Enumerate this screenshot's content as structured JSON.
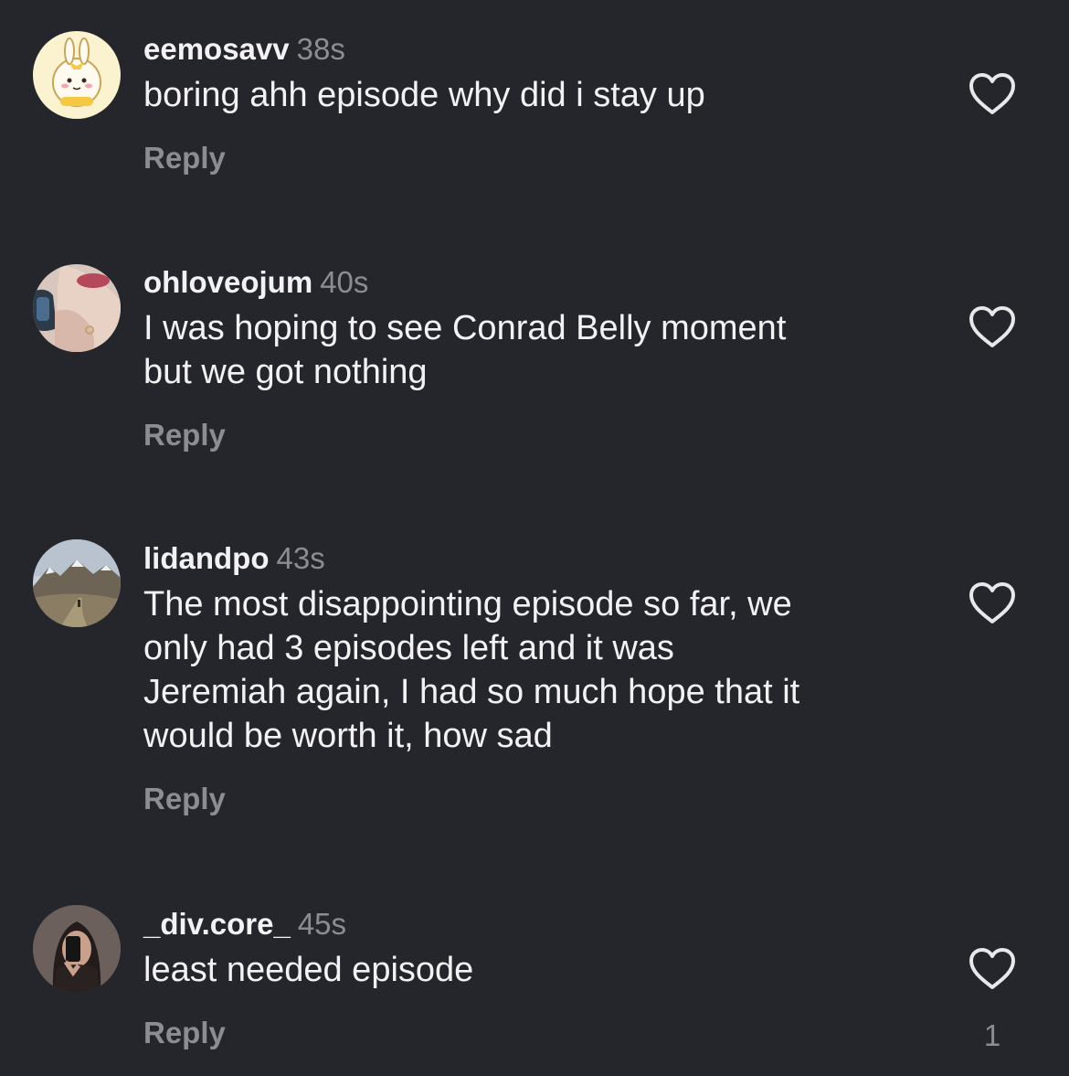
{
  "comments": [
    {
      "username": "eemosavv",
      "time": "38s",
      "text": "boring ahh episode why did i stay up",
      "reply_label": "Reply",
      "avatar_icon": "bunny-character-avatar"
    },
    {
      "username": "ohloveojum",
      "time": "40s",
      "text": "I was hoping to see Conrad Belly moment\nbut we got nothing",
      "reply_label": "Reply",
      "avatar_icon": "person-selfie-avatar"
    },
    {
      "username": "lidandpo",
      "time": "43s",
      "text": "The most disappointing episode so far, we\nonly had 3 episodes left and it was\nJeremiah again, I had so much hope that it\nwould be worth it, how sad",
      "reply_label": "Reply",
      "avatar_icon": "mountain-landscape-avatar"
    },
    {
      "username": "_div.core_",
      "time": "45s",
      "text": "least needed episode",
      "reply_label": "Reply",
      "avatar_icon": "mirror-selfie-avatar",
      "like_count": "1"
    }
  ],
  "colors": {
    "background": "#25262b",
    "primary_text": "#f2f2f4",
    "secondary_text": "#8c8d93",
    "heart_outline": "#e8e8ea"
  },
  "icons": {
    "like": "heart-outline-icon"
  }
}
